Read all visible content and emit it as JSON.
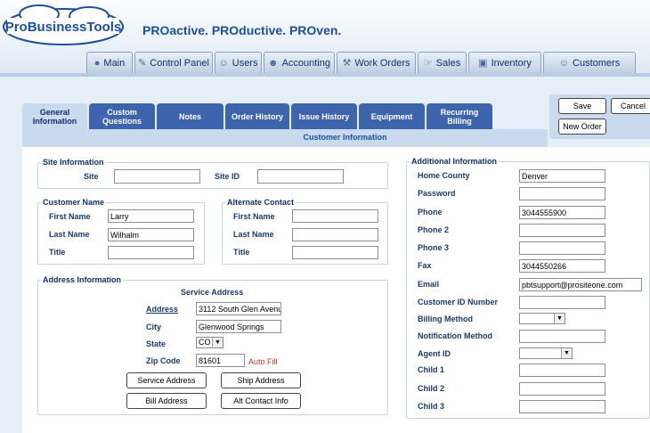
{
  "brand": {
    "logo_text": "ProBusinessTools",
    "tagline": "PROactive. PROductive. PROven."
  },
  "nav": [
    {
      "label": "Main",
      "icon": "globe-icon",
      "glyph": "●"
    },
    {
      "label": "Control Panel",
      "icon": "pencil-icon",
      "glyph": "✎"
    },
    {
      "label": "Users",
      "icon": "users-icon",
      "glyph": "☺"
    },
    {
      "label": "Accounting",
      "icon": "person-icon",
      "glyph": "☻"
    },
    {
      "label": "Work Orders",
      "icon": "wrench-icon",
      "glyph": "⚒"
    },
    {
      "label": "Sales",
      "icon": "hand-icon",
      "glyph": "☞"
    },
    {
      "label": "Inventory",
      "icon": "box-icon",
      "glyph": "▣"
    },
    {
      "label": "Customers",
      "icon": "customers-icon",
      "glyph": "☺"
    }
  ],
  "tabs": [
    "General Information",
    "Custom Questions",
    "Notes",
    "Order History",
    "Issue History",
    "Equipment",
    "Recurring Billing"
  ],
  "section_title": "Customer Information",
  "buttons": {
    "save": "Save",
    "cancel": "Cancel",
    "new_order": "New Order"
  },
  "site_info": {
    "legend": "Site Information",
    "site_label": "Site",
    "site_value": "",
    "site_id_label": "Site ID",
    "site_id_value": ""
  },
  "customer_name": {
    "legend": "Customer Name",
    "first_label": "First Name",
    "first_value": "Larry",
    "last_label": "Last Name",
    "last_value": "Wilhalm",
    "title_label": "Title",
    "title_value": ""
  },
  "alternate_contact": {
    "legend": "Alternate Contact",
    "first_label": "First Name",
    "first_value": "",
    "last_label": "Last Name",
    "last_value": "",
    "title_label": "Title",
    "title_value": ""
  },
  "address": {
    "legend": "Address Information",
    "service_address_title": "Service Address",
    "address_label": "Address",
    "address_value": "3112 South Glen Avenu",
    "city_label": "City",
    "city_value": "Glenwood Springs",
    "state_label": "State",
    "state_value": "CO",
    "zip_label": "Zip Code",
    "zip_value": "81601",
    "auto_fill": "Auto Fill",
    "btn_service": "Service Address",
    "btn_ship": "Ship Address",
    "btn_bill": "Bill Address",
    "btn_alt": "Alt Contact Info"
  },
  "additional": {
    "legend": "Additional Information",
    "home_county_label": "Home County",
    "home_county_value": "Denver",
    "password_label": "Password",
    "password_value": "",
    "phone_label": "Phone",
    "phone_value": "3044555900",
    "phone2_label": "Phone 2",
    "phone2_value": "",
    "phone3_label": "Phone 3",
    "phone3_value": "",
    "fax_label": "Fax",
    "fax_value": "3044550266",
    "email_label": "Email",
    "email_value": "pbtsupport@prositeone.com",
    "customer_id_label": "Customer ID Number",
    "customer_id_value": "",
    "billing_method_label": "Billing Method",
    "billing_method_value": "",
    "notification_label": "Notification Method",
    "notification_value": "",
    "agent_label": "Agent ID",
    "agent_value": "",
    "child1_label": "Child 1",
    "child1_value": "",
    "child2_label": "Child 2",
    "child2_value": "",
    "child3_label": "Child 3",
    "child3_value": ""
  },
  "colors": {
    "accent": "#3d64ac",
    "auto_fill": "#c0392b"
  }
}
